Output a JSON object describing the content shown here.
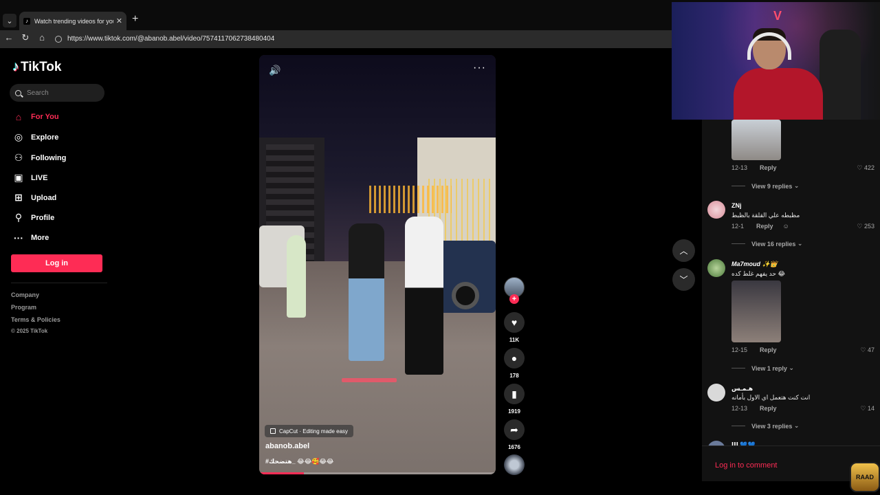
{
  "browser": {
    "tab_title": "Watch trending videos for you | TikTok",
    "url": "https://www.tiktok.com/@abanob.abel/video/7574117062738480404"
  },
  "sidebar": {
    "logo": "TikTok",
    "search_placeholder": "Search",
    "items": [
      {
        "label": "For You",
        "icon": "home-icon"
      },
      {
        "label": "Explore",
        "icon": "compass-icon"
      },
      {
        "label": "Following",
        "icon": "user-plus-icon"
      },
      {
        "label": "LIVE",
        "icon": "tv-icon"
      },
      {
        "label": "Upload",
        "icon": "plus-square-icon"
      },
      {
        "label": "Profile",
        "icon": "user-icon"
      },
      {
        "label": "More",
        "icon": "ellipsis-icon"
      }
    ],
    "login": "Log in",
    "footer": [
      "Company",
      "Program",
      "Terms & Policies",
      "© 2025 TikTok"
    ]
  },
  "video": {
    "capcut": "CapCut · Editing made easy",
    "author": "abanob.abel",
    "caption": "#هتضحك_ 😂😂🥰😂😂",
    "progress": 0.19
  },
  "actions": {
    "likes": "11K",
    "comments": "178",
    "saves": "1919",
    "shares": "1676"
  },
  "comments": {
    "items": [
      {
        "date": "12-13",
        "reply": "Reply",
        "likes": "422",
        "view_replies": "View 9 replies"
      },
      {
        "name": "ZNj",
        "text": "مظبطه علي القلقة بالظبط",
        "date": "12-1",
        "reply": "Reply",
        "likes": "253",
        "view_replies": "View 16 replies"
      },
      {
        "name": "Ma7moud ✨👑",
        "text": "حد يفهم غلط كده 😂",
        "date": "12-15",
        "reply": "Reply",
        "likes": "47",
        "view_replies": "View 1 reply"
      },
      {
        "name": "هـمـس",
        "text": "انت كنت هتعمل اي الاول بأمانه",
        "date": "12-13",
        "reply": "Reply",
        "likes": "14",
        "view_replies": "View 3 replies"
      }
    ],
    "next_name": "ا‍ا‍ا‍ 💙💙",
    "login_prompt": "Log in to comment"
  },
  "overlay": {
    "badge": "RAAD"
  },
  "colors": {
    "accent": "#fe2c55",
    "background": "#000000",
    "panel": "#121212"
  }
}
